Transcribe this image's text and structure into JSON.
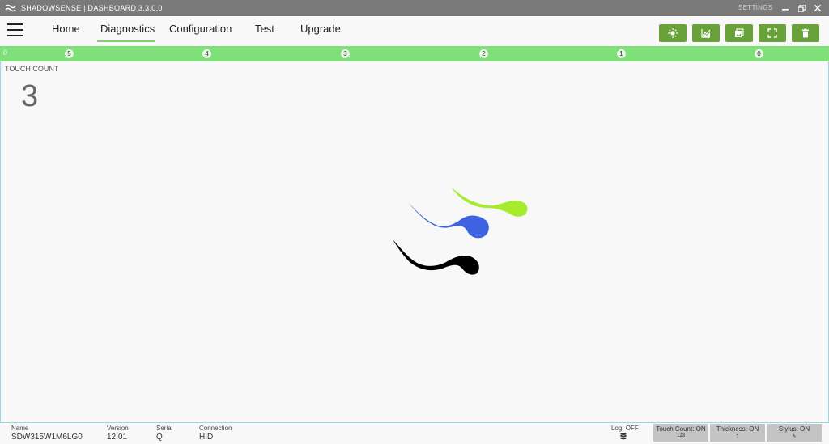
{
  "app": {
    "title": "SHADOWSENSE  |  DASHBOARD  3.3.0.0",
    "settings_label": "SETTINGS",
    "window_buttons": [
      "minimize-icon",
      "restore-icon",
      "close-icon"
    ]
  },
  "nav": {
    "tabs": [
      {
        "label": "Home",
        "active": false
      },
      {
        "label": "Diagnostics",
        "active": true
      },
      {
        "label": "Configuration",
        "active": false
      },
      {
        "label": "Test",
        "active": false
      },
      {
        "label": "Upgrade",
        "active": false
      }
    ],
    "toolbar_buttons": [
      "brightness-icon",
      "chart-icon",
      "image-icon",
      "fullscreen-icon",
      "trash-icon"
    ],
    "accent_color": "#69a23a",
    "active_tab_color": "#7ed36a"
  },
  "ruler": {
    "zero_label": "0",
    "ticks": [
      "5",
      "4",
      "3",
      "2",
      "1",
      "0"
    ],
    "color": "#7fe07a"
  },
  "diagnostics": {
    "touch_count_label": "TOUCH COUNT",
    "touch_count_value": "3",
    "stroke_colors": [
      "#a6ec2c",
      "#3e63e0",
      "#000000"
    ]
  },
  "status": {
    "name_label": "Name",
    "name_value": "SDW315W1M6LG0",
    "version_label": "Version",
    "version_value": "12.01",
    "serial_label": "Serial",
    "serial_value": "Q",
    "connection_label": "Connection",
    "connection_value": "HID",
    "log_label": "Log: OFF",
    "buttons": [
      {
        "label": "Touch Count: ON",
        "sub": "123"
      },
      {
        "label": "Thickness: ON",
        "sub": "⇡"
      },
      {
        "label": "Stylus: ON",
        "sub": "✎"
      }
    ]
  }
}
